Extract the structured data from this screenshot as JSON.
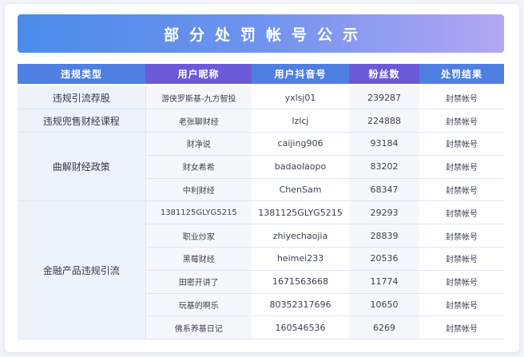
{
  "title": "部分处罚帐号公示",
  "headers": {
    "type": "违规类型",
    "nickname": "用户昵称",
    "account": "用户抖音号",
    "fans": "粉丝数",
    "result": "处罚结果"
  },
  "groups": [
    {
      "type": "违规引流荐股",
      "rows": [
        {
          "nickname": "游侠罗斯基-九方智投",
          "account": "yxlsj01",
          "fans": "239287",
          "result": "封禁帐号"
        }
      ]
    },
    {
      "type": "违规兜售财经课程",
      "rows": [
        {
          "nickname": "老张聊财经",
          "account": "lzlcj",
          "fans": "224888",
          "result": "封禁帐号"
        }
      ]
    },
    {
      "type": "曲解财经政策",
      "rows": [
        {
          "nickname": "财净说",
          "account": "caijing906",
          "fans": "93184",
          "result": "封禁帐号"
        },
        {
          "nickname": "财女希希",
          "account": "badaolaopo",
          "fans": "83202",
          "result": "封禁帐号"
        },
        {
          "nickname": "中利财经",
          "account": "ChenSam",
          "fans": "68347",
          "result": "封禁帐号"
        }
      ]
    },
    {
      "type": "金融产品违规引流",
      "rows": [
        {
          "nickname": "1381125GLYG5215",
          "account": "1381125GLYG5215",
          "fans": "29293",
          "result": "封禁帐号"
        },
        {
          "nickname": "职业炒家",
          "account": "zhiyechaojia",
          "fans": "28839",
          "result": "封禁帐号"
        },
        {
          "nickname": "黑莓财经",
          "account": "heimei233",
          "fans": "20536",
          "result": "封禁帐号"
        },
        {
          "nickname": "田密开讲了",
          "account": "1671563668",
          "fans": "11774",
          "result": "封禁帐号"
        },
        {
          "nickname": "玩基的啊乐",
          "account": "80352317696",
          "fans": "10650",
          "result": "封禁帐号"
        },
        {
          "nickname": "佛系养基日记",
          "account": "160546536",
          "fans": "6269",
          "result": "封禁帐号"
        }
      ]
    }
  ]
}
